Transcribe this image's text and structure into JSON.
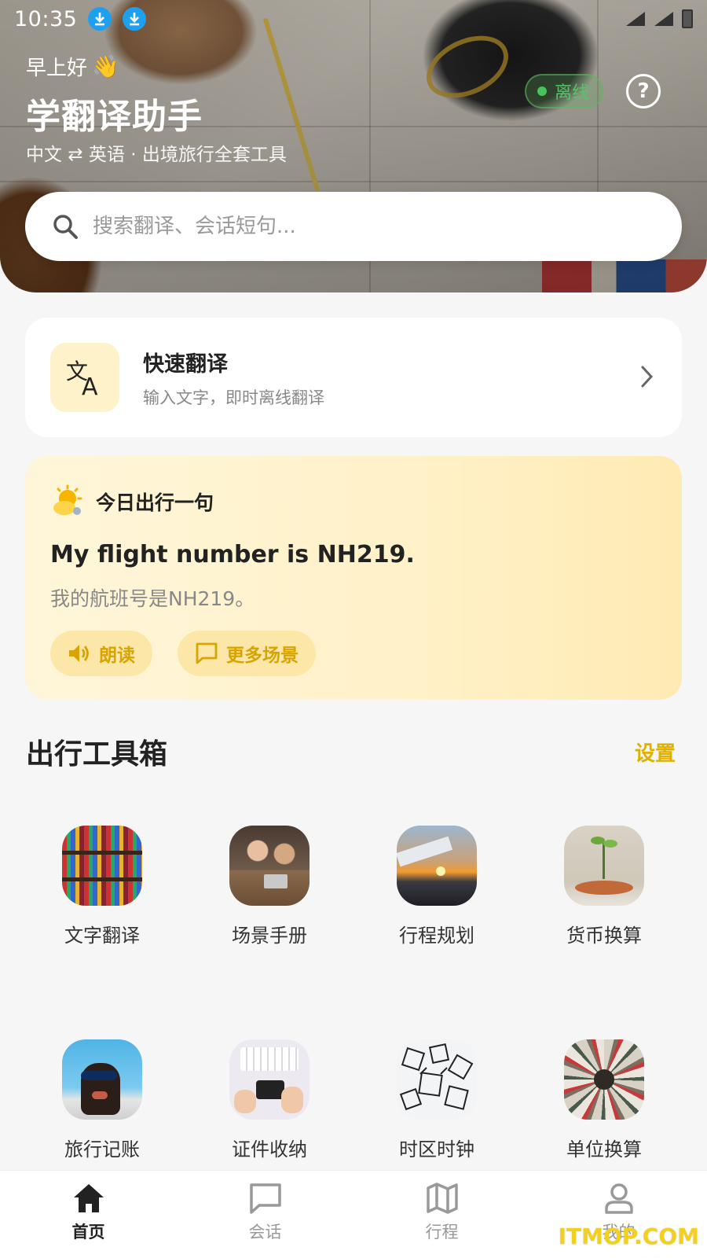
{
  "status_bar": {
    "time": "10:35"
  },
  "header": {
    "greeting": "早上好",
    "greeting_emoji": "👋",
    "title": "学翻译助手",
    "subtitle": "中文 ⇄ 英语 · 出境旅行全套工具",
    "offline_badge": "离线",
    "help_label": "?"
  },
  "search": {
    "placeholder": "搜索翻译、会话短句..."
  },
  "quick_translate": {
    "title": "快速翻译",
    "description": "输入文字，即时离线翻译"
  },
  "phrase_of_day": {
    "heading": "今日出行一句",
    "english": "My flight number is NH219.",
    "chinese": "我的航班号是NH219。",
    "read_button": "朗读",
    "more_button": "更多场景"
  },
  "toolbox": {
    "title": "出行工具箱",
    "settings": "设置",
    "tools": [
      {
        "label": "文字翻译",
        "icon": "bookshelf-photo"
      },
      {
        "label": "场景手册",
        "icon": "people-meeting-photo"
      },
      {
        "label": "行程规划",
        "icon": "airplane-sunset-photo"
      },
      {
        "label": "货币换算",
        "icon": "coins-plant-photo"
      },
      {
        "label": "旅行记账",
        "icon": "dog-sunglasses-photo"
      },
      {
        "label": "证件收纳",
        "icon": "keyboard-phone-photo"
      },
      {
        "label": "时区时钟",
        "icon": "wire-cubes-photo"
      },
      {
        "label": "单位换算",
        "icon": "paper-spiral-photo"
      }
    ]
  },
  "bottom_nav": {
    "items": [
      {
        "label": "首页",
        "icon": "home-icon",
        "active": true
      },
      {
        "label": "会话",
        "icon": "chat-icon",
        "active": false
      },
      {
        "label": "行程",
        "icon": "map-icon",
        "active": false
      },
      {
        "label": "我的",
        "icon": "profile-icon",
        "active": false
      }
    ]
  },
  "watermark": "ITMOP.COM",
  "colors": {
    "accent": "#e0b000",
    "offline_green": "#46c35a",
    "download_blue": "#1ea0f0"
  }
}
